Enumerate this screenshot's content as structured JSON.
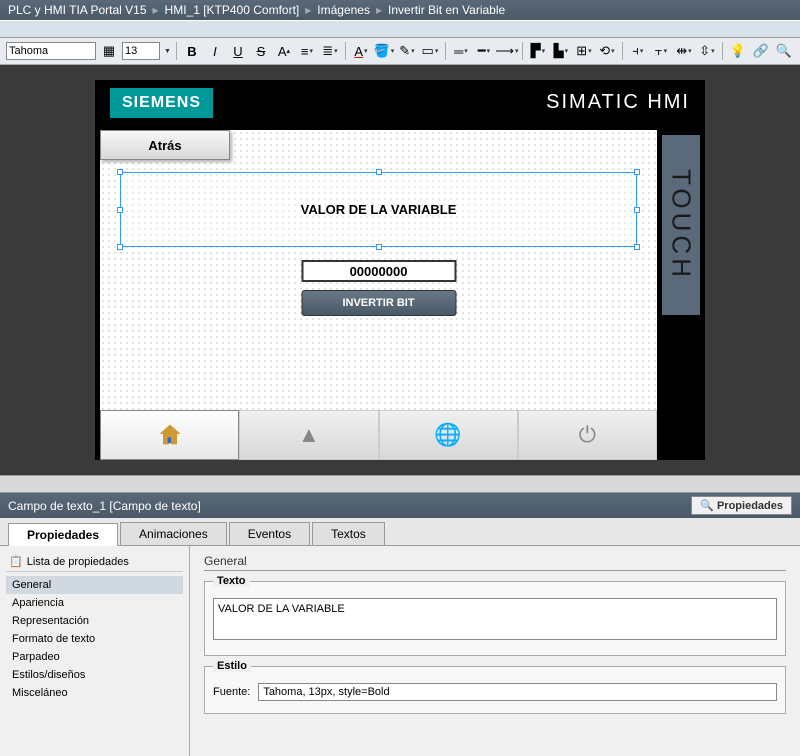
{
  "breadcrumb": [
    "PLC y HMI TIA Portal V15",
    "HMI_1 [KTP400 Comfort]",
    "Imágenes",
    "Invertir Bit en Variable"
  ],
  "toolbar": {
    "font": "Tahoma",
    "size": "13"
  },
  "hmi": {
    "brand": "SIEMENS",
    "product": "SIMATIC HMI",
    "touch": "TOUCH",
    "back": "Atrás",
    "var_label": "VALOR DE LA VARIABLE",
    "io_value": "00000000",
    "invert": "INVERTIR BIT"
  },
  "inspector": {
    "title": "Campo de texto_1 [Campo de texto]",
    "props_tab": "Propiedades",
    "tabs": [
      "Propiedades",
      "Animaciones",
      "Eventos",
      "Textos"
    ],
    "list_header": "Lista de propiedades",
    "items": [
      "General",
      "Apariencia",
      "Representación",
      "Formato de texto",
      "Parpadeo",
      "Estilos/diseños",
      "Misceláneo"
    ],
    "section": "General",
    "group_text": "Texto",
    "text_value": "VALOR DE LA VARIABLE",
    "group_style": "Estilo",
    "font_label": "Fuente:",
    "font_value": "Tahoma, 13px, style=Bold"
  }
}
